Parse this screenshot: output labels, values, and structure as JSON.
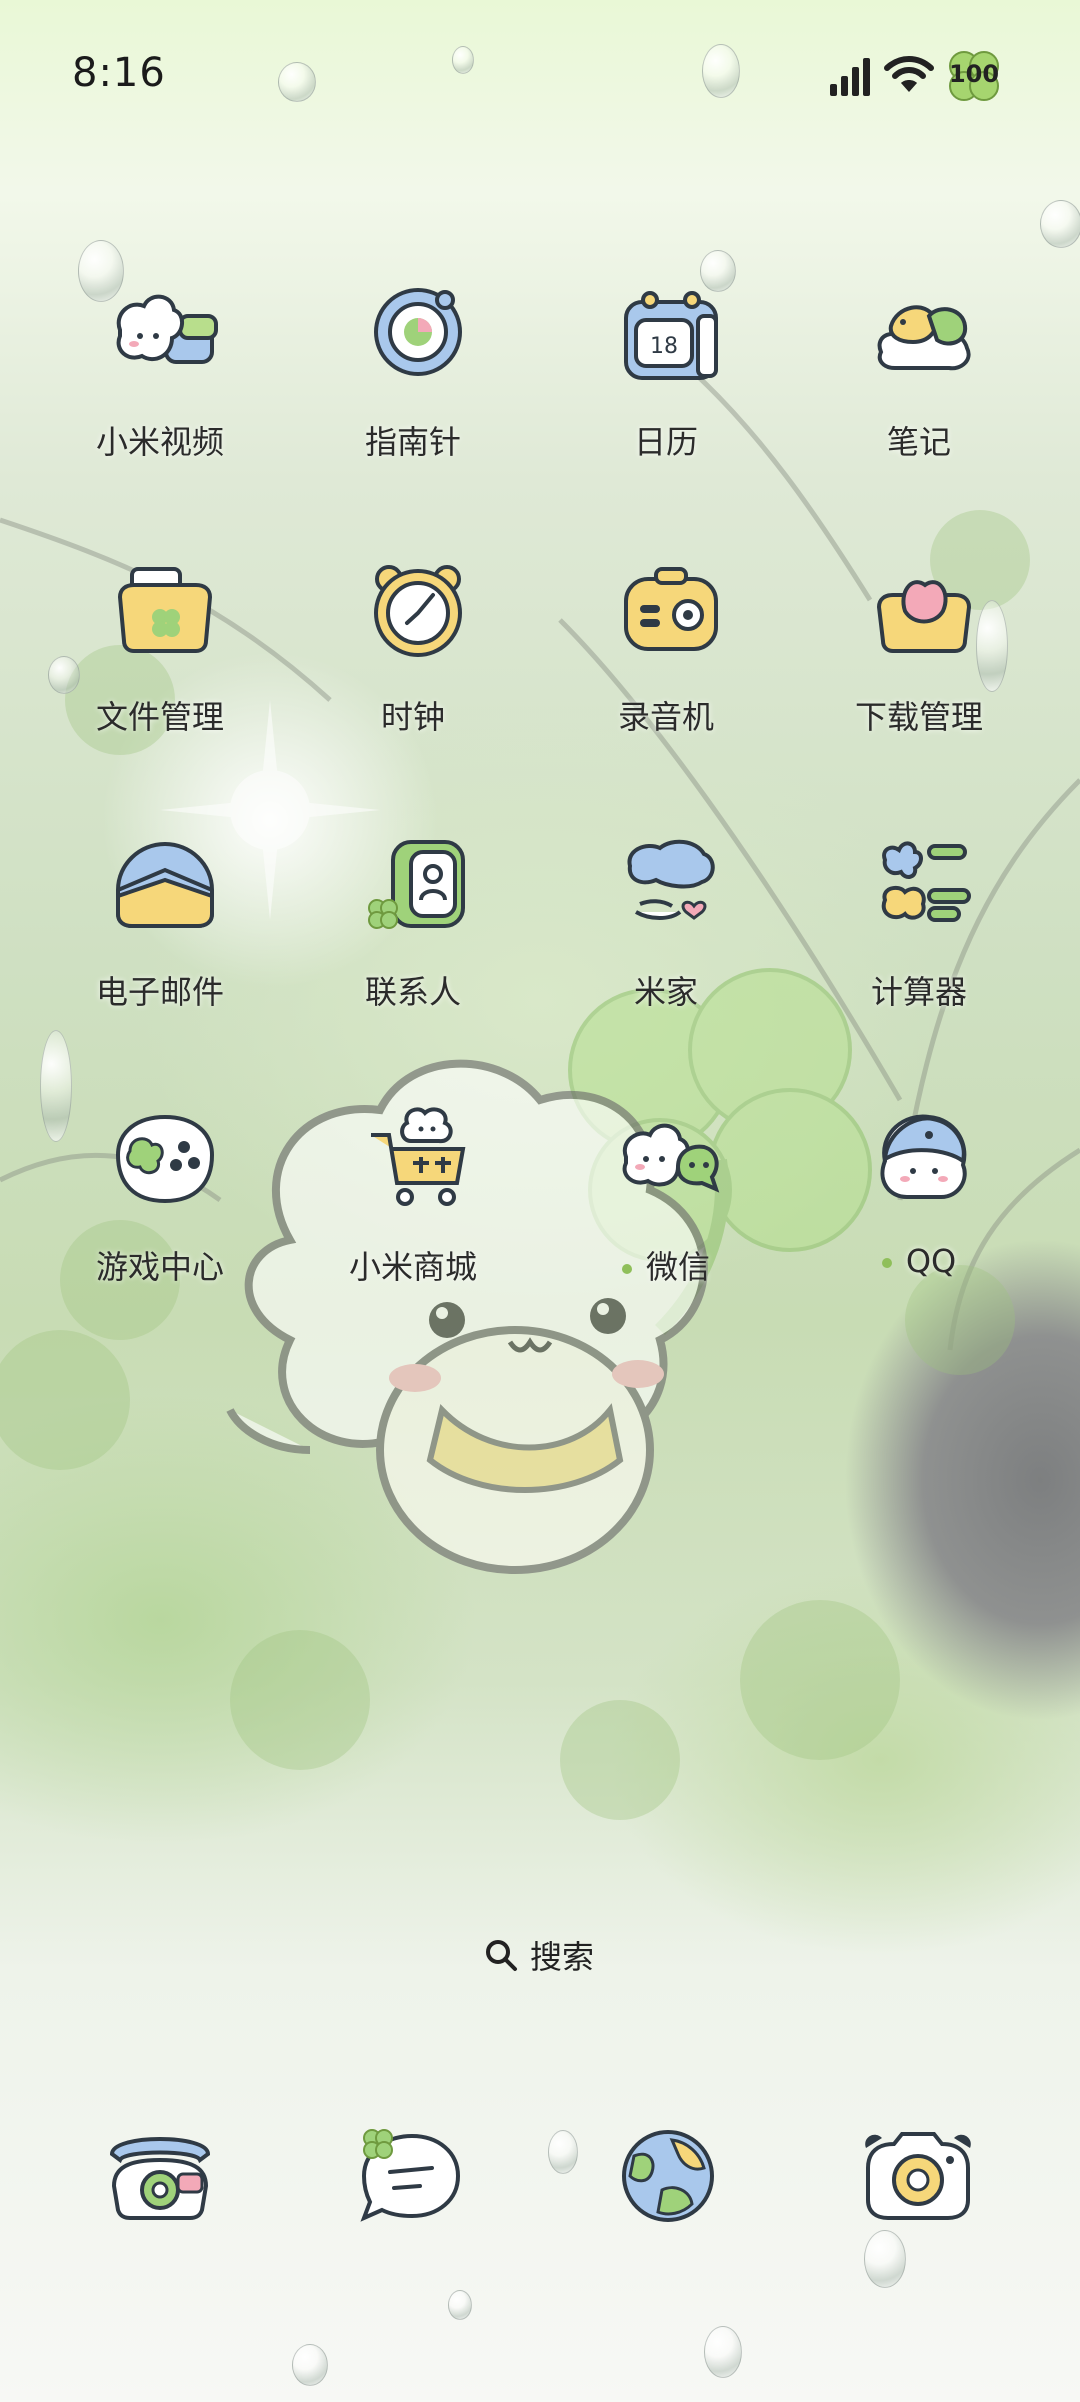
{
  "status_bar": {
    "time": "8:16",
    "battery_level": "100",
    "signal_icon": "signal-bars-icon",
    "wifi_icon": "wifi-icon"
  },
  "apps": [
    {
      "label": "小米视频",
      "icon": "video-sheep-icon"
    },
    {
      "label": "指南针",
      "icon": "compass-icon"
    },
    {
      "label": "日历",
      "icon": "calendar-icon",
      "icon_text": "18"
    },
    {
      "label": "笔记",
      "icon": "notes-icon"
    },
    {
      "label": "文件管理",
      "icon": "file-manager-icon"
    },
    {
      "label": "时钟",
      "icon": "clock-icon"
    },
    {
      "label": "录音机",
      "icon": "recorder-icon"
    },
    {
      "label": "下载管理",
      "icon": "download-icon"
    },
    {
      "label": "电子邮件",
      "icon": "email-icon"
    },
    {
      "label": "联系人",
      "icon": "contacts-icon"
    },
    {
      "label": "米家",
      "icon": "mijia-icon"
    },
    {
      "label": "计算器",
      "icon": "calculator-icon"
    },
    {
      "label": "游戏中心",
      "icon": "game-center-icon"
    },
    {
      "label": "小米商城",
      "icon": "mi-store-icon"
    },
    {
      "label": "微信",
      "icon": "wechat-icon",
      "new_dot": true
    },
    {
      "label": "QQ",
      "icon": "qq-icon",
      "new_dot": true
    }
  ],
  "search": {
    "label": "搜索",
    "icon": "search-icon"
  },
  "dock": [
    {
      "icon": "phone-icon"
    },
    {
      "icon": "messages-icon"
    },
    {
      "icon": "browser-globe-icon"
    },
    {
      "icon": "camera-icon"
    }
  ],
  "colors": {
    "icon_outline": "#2f3a45",
    "accent_yellow": "#f6d77a",
    "accent_blue": "#a9c8ec",
    "accent_green": "#9fd27a",
    "accent_pink": "#f3a9b8"
  }
}
